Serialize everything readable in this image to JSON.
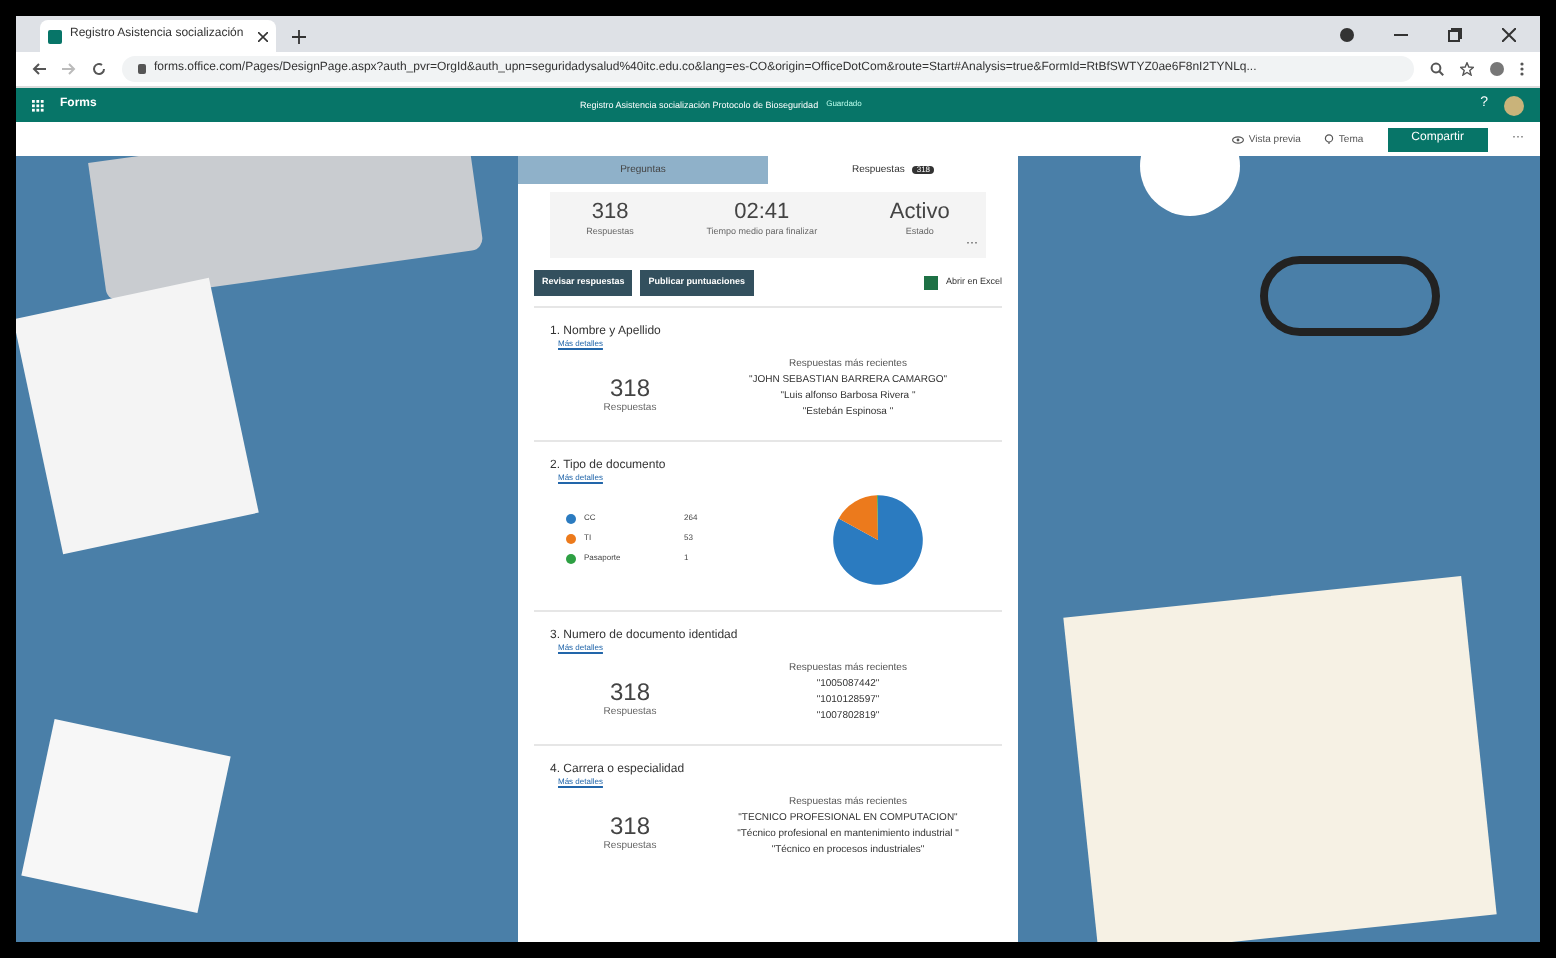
{
  "browser": {
    "tab_title": "Registro Asistencia socialización",
    "url": "forms.office.com/Pages/DesignPage.aspx?auth_pvr=OrgId&auth_upn=seguridadysalud%40itc.edu.co&lang=es-CO&origin=OfficeDotCom&route=Start#Analysis=true&FormId=RtBfSWTYZ0ae6F8nI2TYNLq..."
  },
  "app_bar": {
    "app_name": "Forms",
    "form_title": "Registro Asistencia socialización Protocolo de Bioseguridad",
    "saved_label": "Guardado",
    "help": "?"
  },
  "command_bar": {
    "preview": "Vista previa",
    "theme": "Tema",
    "share": "Compartir",
    "more": "···"
  },
  "tabs": [
    {
      "label": "Preguntas",
      "selected": false
    },
    {
      "label": "Respuestas",
      "selected": true,
      "badge": "318"
    }
  ],
  "summary": [
    {
      "value": "318",
      "label": "Respuestas"
    },
    {
      "value": "02:41",
      "label": "Tiempo medio para finalizar"
    },
    {
      "value": "Activo",
      "label": "Estado"
    }
  ],
  "summary_more": "···",
  "actions": {
    "buttons": [
      "Revisar respuestas",
      "Publicar puntuaciones"
    ],
    "excel": "Abrir en Excel"
  },
  "questions": [
    {
      "kind": "text",
      "title": "1. Nombre y Apellido",
      "details": "Más detalles",
      "count": "318",
      "count_label": "Respuestas",
      "recent_label": "Respuestas más recientes",
      "recent": [
        "\"JOHN SEBASTIAN BARRERA CAMARGO\"",
        "\"Luis alfonso Barbosa Rivera \"",
        "\"Estebán Espinosa \""
      ]
    },
    {
      "kind": "choice",
      "title": "2. Tipo de documento",
      "details": "Más detalles",
      "options": [
        {
          "count": "264",
          "color": "#2b7bc0"
        },
        {
          "count": "53",
          "color": "#ec7a1c"
        },
        {
          "count": "1",
          "color": "#2ea043"
        }
      ],
      "chart_data": {
        "type": "pie",
        "categories": [
          "CC",
          "TI",
          "Pasaporte"
        ],
        "values": [
          83.0,
          16.7,
          0.3
        ]
      }
    },
    {
      "kind": "text",
      "title": "3. Numero de documento identidad",
      "details": "Más detalles",
      "count": "318",
      "count_label": "Respuestas",
      "recent_label": "Respuestas más recientes",
      "recent": [
        "\"1005087442\"",
        "\"1010128597\"",
        "\"1007802819\""
      ]
    },
    {
      "kind": "text",
      "title": "4. Carrera o especialidad",
      "details": "Más detalles",
      "count": "318",
      "count_label": "Respuestas",
      "recent_label": "Respuestas más recientes",
      "recent": [
        "\"TECNICO PROFESIONAL EN COMPUTACION\"",
        "\"Técnico profesional en mantenimiento industrial \"",
        "\"Técnico en procesos industriales\""
      ]
    }
  ]
}
